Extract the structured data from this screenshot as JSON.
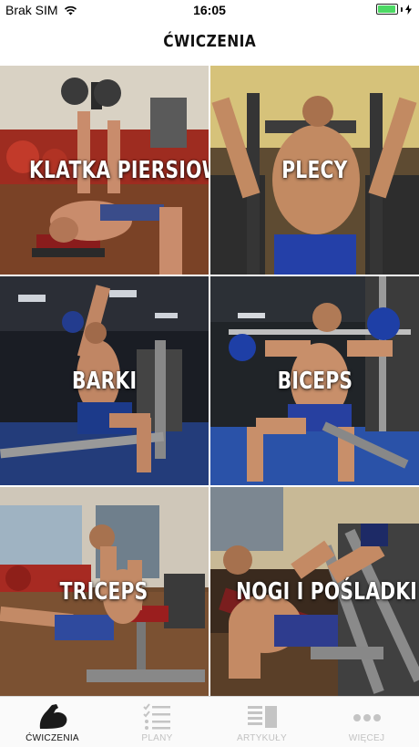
{
  "status_bar": {
    "carrier": "Brak SIM",
    "time": "16:05",
    "battery_color": "#4cd964"
  },
  "header": {
    "title": "ĆWICZENIA"
  },
  "categories": [
    {
      "label": "KLATKA PIERSIOWA"
    },
    {
      "label": "PLECY"
    },
    {
      "label": "BARKI"
    },
    {
      "label": "BICEPS"
    },
    {
      "label": "TRICEPS"
    },
    {
      "label": "NOGI I POŚLADKI"
    }
  ],
  "tab_bar": {
    "tabs": [
      {
        "label": "ĆWICZENIA",
        "icon": "biceps-icon",
        "active": true
      },
      {
        "label": "PLANY",
        "icon": "checklist-icon",
        "active": false
      },
      {
        "label": "ARTYKUŁY",
        "icon": "articles-icon",
        "active": false
      },
      {
        "label": "WIĘCEJ",
        "icon": "more-icon",
        "active": false
      }
    ]
  }
}
